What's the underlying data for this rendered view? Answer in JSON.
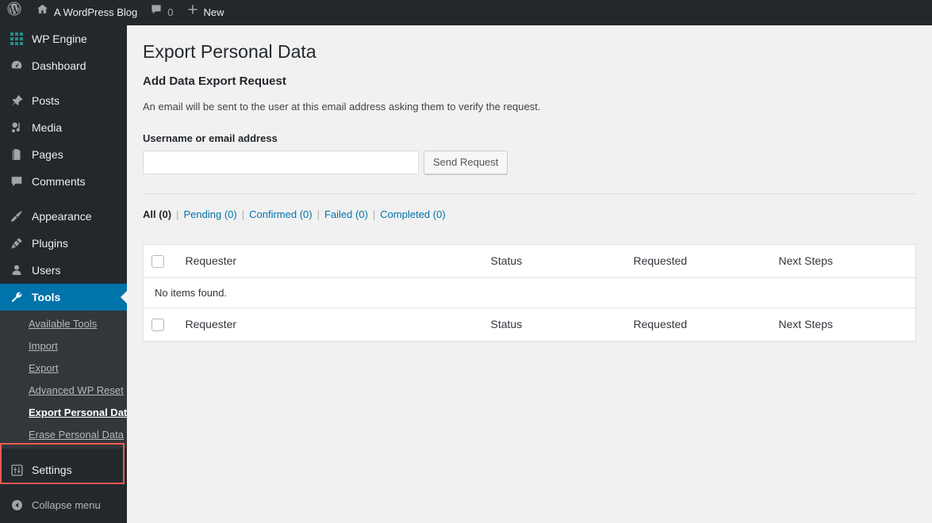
{
  "adminbar": {
    "wp_logo": "wordpress-logo-icon",
    "site_home_icon": "home-icon",
    "site_name": "A WordPress Blog",
    "comments_icon": "comment-bubble-icon",
    "comments_count": "0",
    "new_icon": "plus-icon",
    "new_label": "New"
  },
  "sidebar": {
    "items": [
      {
        "label": "WP Engine",
        "icon": "wp-engine-grid-icon",
        "current": false,
        "separator_after": false
      },
      {
        "label": "Dashboard",
        "icon": "dashboard-gauge-icon",
        "current": false,
        "separator_after": true
      },
      {
        "label": "Posts",
        "icon": "pin-icon",
        "current": false,
        "separator_after": false
      },
      {
        "label": "Media",
        "icon": "media-icon",
        "current": false,
        "separator_after": false
      },
      {
        "label": "Pages",
        "icon": "pages-icon",
        "current": false,
        "separator_after": false
      },
      {
        "label": "Comments",
        "icon": "comment-bubble-icon",
        "current": false,
        "separator_after": true
      },
      {
        "label": "Appearance",
        "icon": "paintbrush-icon",
        "current": false,
        "separator_after": false
      },
      {
        "label": "Plugins",
        "icon": "plug-icon",
        "current": false,
        "separator_after": false
      },
      {
        "label": "Users",
        "icon": "user-icon",
        "current": false,
        "separator_after": false
      },
      {
        "label": "Tools",
        "icon": "wrench-icon",
        "current": true,
        "separator_after": false
      }
    ],
    "submenu": [
      {
        "label": "Available Tools",
        "current": false
      },
      {
        "label": "Import",
        "current": false
      },
      {
        "label": "Export",
        "current": false
      },
      {
        "label": "Advanced WP Reset",
        "current": false
      },
      {
        "label": "Export Personal Data",
        "current": true
      },
      {
        "label": "Erase Personal Data",
        "current": false
      }
    ],
    "after_submenu": [
      {
        "label": "Settings",
        "icon": "settings-sliders-icon",
        "current": false
      },
      {
        "label": "Collapse menu",
        "icon": "collapse-arrow-icon",
        "current": false
      }
    ]
  },
  "annotation": {
    "color": "#f05a50",
    "target": "export-and-erase-personal-data-submenu-items"
  },
  "main": {
    "page_title": "Export Personal Data",
    "section_title": "Add Data Export Request",
    "description": "An email will be sent to the user at this email address asking them to verify the request.",
    "field_label": "Username or email address",
    "input_value": "",
    "input_placeholder": "",
    "submit_label": "Send Request",
    "filters": [
      {
        "label": "All (0)",
        "current": true
      },
      {
        "label": "Pending (0)",
        "current": false
      },
      {
        "label": "Confirmed (0)",
        "current": false
      },
      {
        "label": "Failed (0)",
        "current": false
      },
      {
        "label": "Completed (0)",
        "current": false
      }
    ],
    "filter_separator": "|",
    "table": {
      "columns": [
        "Requester",
        "Status",
        "Requested",
        "Next Steps"
      ],
      "rows": [],
      "empty_message": "No items found."
    }
  },
  "colors": {
    "admin_bar": "#23282d",
    "sidebar": "#23282d",
    "submenu": "#32373c",
    "current_highlight": "#0073aa",
    "link": "#0073aa",
    "content_bg": "#f1f1f1",
    "annotation": "#f05a50"
  }
}
